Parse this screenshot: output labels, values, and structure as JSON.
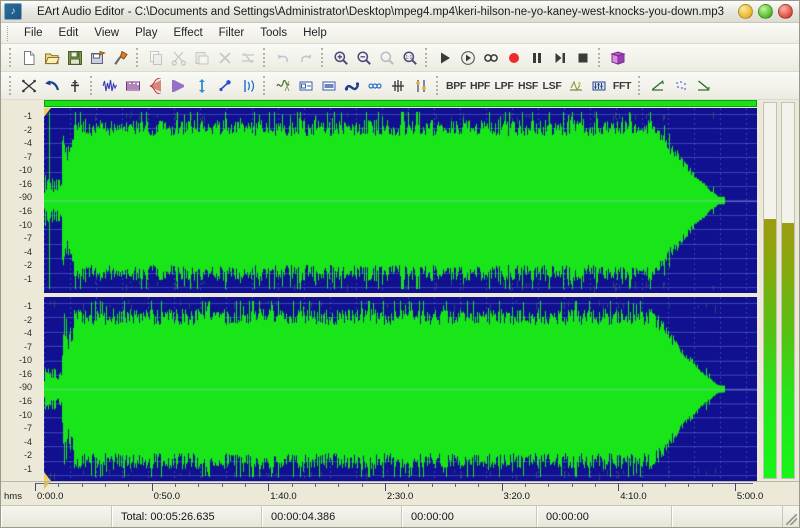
{
  "window": {
    "app_name": "EArt Audio Editor",
    "title": "EArt Audio Editor - C:\\Documents and Settings\\Administrator\\Desktop\\mpeg4.mp4\\keri-hilson-ne-yo-kaney-west-knocks-you-down.mp3",
    "icon": "app-logo-icon",
    "buttons": {
      "minimize": "minimize",
      "maximize": "maximize",
      "close": "close"
    }
  },
  "menubar": {
    "items": [
      {
        "label": "File"
      },
      {
        "label": "Edit"
      },
      {
        "label": "View"
      },
      {
        "label": "Play"
      },
      {
        "label": "Effect"
      },
      {
        "label": "Filter"
      },
      {
        "label": "Tools"
      },
      {
        "label": "Help"
      }
    ]
  },
  "toolbar_main": {
    "groups": [
      {
        "items": [
          {
            "name": "new-file",
            "icon": "new-document-icon",
            "enabled": true
          },
          {
            "name": "open-file",
            "icon": "open-folder-icon",
            "enabled": true
          },
          {
            "name": "save-file",
            "icon": "floppy-save-icon",
            "enabled": true
          },
          {
            "name": "save-as",
            "icon": "save-as-icon",
            "enabled": true
          },
          {
            "name": "batch-convert",
            "icon": "tools-hammer-icon",
            "enabled": true
          }
        ]
      },
      {
        "items": [
          {
            "name": "copy",
            "icon": "copy-icon",
            "enabled": false
          },
          {
            "name": "cut",
            "icon": "scissors-icon",
            "enabled": false
          },
          {
            "name": "paste",
            "icon": "paste-icon",
            "enabled": false
          },
          {
            "name": "delete",
            "icon": "delete-x-icon",
            "enabled": false
          },
          {
            "name": "trim",
            "icon": "trim-icon",
            "enabled": false
          }
        ]
      },
      {
        "items": [
          {
            "name": "undo",
            "icon": "undo-arrow-icon",
            "enabled": false
          },
          {
            "name": "redo",
            "icon": "redo-arrow-icon",
            "enabled": false
          }
        ]
      },
      {
        "items": [
          {
            "name": "zoom-in",
            "icon": "zoom-in-icon",
            "enabled": true
          },
          {
            "name": "zoom-out",
            "icon": "zoom-out-icon",
            "enabled": true
          },
          {
            "name": "zoom-selection",
            "icon": "zoom-selection-icon",
            "enabled": false
          },
          {
            "name": "zoom-full",
            "icon": "zoom-full-icon",
            "enabled": true
          }
        ]
      },
      {
        "items": [
          {
            "name": "play",
            "icon": "play-icon",
            "enabled": true
          },
          {
            "name": "play-selection",
            "icon": "play-circle-icon",
            "enabled": true
          },
          {
            "name": "loop",
            "icon": "loop-infinity-icon",
            "enabled": true
          },
          {
            "name": "record",
            "icon": "record-icon",
            "enabled": true
          },
          {
            "name": "pause",
            "icon": "pause-icon",
            "enabled": true
          },
          {
            "name": "step-forward",
            "icon": "step-forward-icon",
            "enabled": true
          },
          {
            "name": "stop",
            "icon": "stop-icon",
            "enabled": true
          }
        ]
      },
      {
        "items": [
          {
            "name": "help-book",
            "icon": "book-help-icon",
            "enabled": true
          }
        ]
      }
    ]
  },
  "toolbar_effects": {
    "groups": [
      {
        "items": [
          {
            "name": "mixer",
            "icon": "mix-icon",
            "enabled": true
          },
          {
            "name": "reverse",
            "icon": "reverse-arrow-icon",
            "enabled": true
          },
          {
            "name": "insert-silence",
            "icon": "silence-icon",
            "enabled": true
          }
        ]
      },
      {
        "items": [
          {
            "name": "amplify",
            "icon": "amplify-wave-icon",
            "enabled": true
          },
          {
            "name": "normalize",
            "icon": "normalize-icon",
            "enabled": true
          },
          {
            "name": "fade-in",
            "icon": "fade-in-icon",
            "enabled": true
          },
          {
            "name": "fade-out",
            "icon": "fade-out-icon",
            "enabled": true
          },
          {
            "name": "pitch-shift",
            "icon": "pitch-updown-icon",
            "enabled": true
          },
          {
            "name": "speed-change",
            "icon": "speed-icon",
            "enabled": true
          },
          {
            "name": "echo",
            "icon": "echo-waves-icon",
            "enabled": true
          }
        ]
      },
      {
        "items": [
          {
            "name": "noise-reduction",
            "icon": "noise-reduce-icon",
            "enabled": true
          },
          {
            "name": "crop-region",
            "icon": "crop-region-icon",
            "enabled": true
          },
          {
            "name": "compressor",
            "icon": "compressor-icon",
            "enabled": true
          },
          {
            "name": "flanger",
            "icon": "flanger-icon",
            "enabled": true
          },
          {
            "name": "chorus",
            "icon": "chorus-icon",
            "enabled": true
          },
          {
            "name": "invert",
            "icon": "invert-icon",
            "enabled": true
          },
          {
            "name": "vibrato",
            "icon": "vibrato-icon",
            "enabled": true
          }
        ]
      },
      {
        "items": [
          {
            "name": "band-pass-filter",
            "icon": "text-label",
            "label": "BPF",
            "enabled": true
          },
          {
            "name": "high-pass-filter",
            "icon": "text-label",
            "label": "HPF",
            "enabled": true
          },
          {
            "name": "low-pass-filter",
            "icon": "text-label",
            "label": "LPF",
            "enabled": true
          },
          {
            "name": "high-shelf-filter",
            "icon": "text-label",
            "label": "HSF",
            "enabled": true
          },
          {
            "name": "low-shelf-filter",
            "icon": "text-label",
            "label": "LSF",
            "enabled": true
          },
          {
            "name": "notch-filter",
            "icon": "notch-filter-icon",
            "enabled": true
          },
          {
            "name": "equalizer",
            "icon": "equalizer-icon",
            "enabled": true
          },
          {
            "name": "fft-filter",
            "icon": "text-label",
            "label": "FFT",
            "enabled": true
          }
        ]
      },
      {
        "items": [
          {
            "name": "envelope-up",
            "icon": "envelope-up-icon",
            "enabled": true
          },
          {
            "name": "dither",
            "icon": "dither-icon",
            "enabled": true
          },
          {
            "name": "envelope-down",
            "icon": "envelope-down-icon",
            "enabled": true
          }
        ]
      }
    ]
  },
  "editor": {
    "db_scale": [
      "-1",
      "-2",
      "-4",
      "-7",
      "-10",
      "-16",
      "-90",
      "-16",
      "-10",
      "-7",
      "-4",
      "-2",
      "-1"
    ],
    "channels": [
      {
        "name": "channel-left"
      },
      {
        "name": "channel-right"
      }
    ],
    "selection_highlight": true,
    "vu_meters": [
      {
        "name": "vu-meter-left",
        "level_percent": 69
      },
      {
        "name": "vu-meter-right",
        "level_percent": 68
      }
    ]
  },
  "time_ruler": {
    "unit_label": "hms",
    "labels": [
      "0:00.0",
      "0:50.0",
      "1:40.0",
      "2:30.0",
      "3:20.0",
      "4:10.0",
      "5:00.0"
    ],
    "positions_percent": [
      0,
      16.2,
      32.4,
      48.6,
      64.8,
      81.0,
      97.2
    ]
  },
  "statusbar": {
    "left_message": "",
    "total_label": "Total: 00:05:26.635",
    "selection_length": "00:00:04.386",
    "position_start": "00:00:00",
    "position_end": "00:00:00",
    "right_message": ""
  },
  "colors": {
    "waveform": "#19e619",
    "waveform_background": "#101090",
    "selection_bar": "#17e317",
    "window_background": "#ece9d8",
    "vu_top": "#9c9c10",
    "vu_bottom": "#17f51a"
  }
}
